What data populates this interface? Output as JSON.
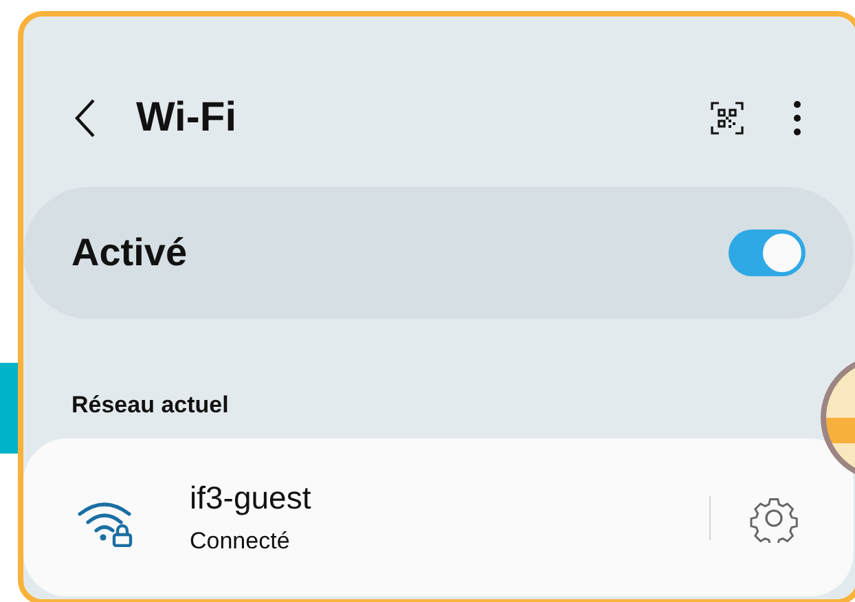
{
  "header": {
    "title": "Wi-Fi"
  },
  "master_switch": {
    "label": "Activé",
    "on": true
  },
  "section_title": "Réseau actuel",
  "current_network": {
    "name": "if3-guest",
    "status": "Connecté",
    "secured": true
  }
}
